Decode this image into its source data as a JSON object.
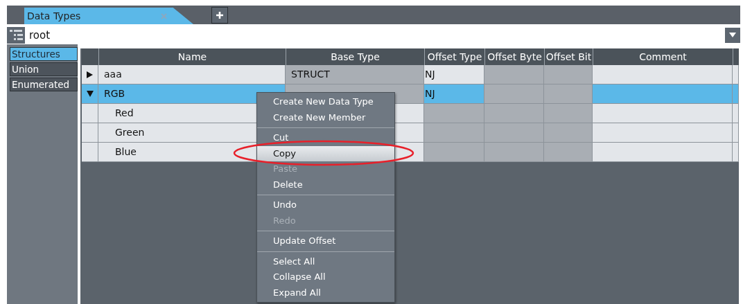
{
  "tabs": [
    {
      "label": "Data Types",
      "selected": true,
      "closable": true
    }
  ],
  "path_bar": {
    "value": "root"
  },
  "categories": [
    {
      "label": "Structures",
      "selected": true
    },
    {
      "label": "Union",
      "selected": false
    },
    {
      "label": "Enumerated",
      "selected": false
    }
  ],
  "table": {
    "columns": [
      "Name",
      "Base Type",
      "Offset Type",
      "Offset Byte",
      "Offset Bit",
      "Comment"
    ],
    "rows": [
      {
        "kind": "struct",
        "expanded": false,
        "selected": false,
        "cells": [
          {
            "text": "aaa",
            "editable": true
          },
          {
            "text": "STRUCT",
            "editable": false
          },
          {
            "text": "NJ",
            "editable": true
          },
          {
            "editable": false
          },
          {
            "editable": false
          },
          {
            "editable": true
          }
        ]
      },
      {
        "kind": "struct",
        "expanded": true,
        "selected": true,
        "cells": [
          {
            "text": "RGB",
            "editable": true
          },
          {
            "editable": false
          },
          {
            "text": "NJ",
            "editable": true
          },
          {
            "editable": false
          },
          {
            "editable": false
          },
          {
            "editable": true
          }
        ]
      },
      {
        "kind": "member",
        "selected": false,
        "cells": [
          {
            "text": "Red",
            "editable": true
          },
          {
            "editable": true
          },
          {
            "editable": false
          },
          {
            "editable": false
          },
          {
            "editable": false
          },
          {
            "editable": true
          }
        ]
      },
      {
        "kind": "member",
        "selected": false,
        "cells": [
          {
            "text": "Green",
            "editable": true
          },
          {
            "editable": true
          },
          {
            "editable": false
          },
          {
            "editable": false
          },
          {
            "editable": false
          },
          {
            "editable": true
          }
        ]
      },
      {
        "kind": "member",
        "selected": false,
        "cells": [
          {
            "text": "Blue",
            "editable": true
          },
          {
            "editable": true
          },
          {
            "editable": false
          },
          {
            "editable": false
          },
          {
            "editable": false
          },
          {
            "editable": true
          }
        ]
      }
    ]
  },
  "context_menu": {
    "groups": [
      [
        {
          "label": "Create New Data Type",
          "disabled": false,
          "selected": false
        },
        {
          "label": "Create New Member",
          "disabled": false,
          "selected": false
        }
      ],
      [
        {
          "label": "Cut",
          "disabled": false,
          "selected": false
        },
        {
          "label": "Copy",
          "disabled": false,
          "selected": true
        },
        {
          "label": "Paste",
          "disabled": true,
          "selected": false
        },
        {
          "label": "Delete",
          "disabled": false,
          "selected": false
        }
      ],
      [
        {
          "label": "Undo",
          "disabled": false,
          "selected": false
        },
        {
          "label": "Redo",
          "disabled": true,
          "selected": false
        }
      ],
      [
        {
          "label": "Update Offset",
          "disabled": false,
          "selected": false
        }
      ],
      [
        {
          "label": "Select All",
          "disabled": false,
          "selected": false
        },
        {
          "label": "Collapse All",
          "disabled": false,
          "selected": false
        },
        {
          "label": "Expand All",
          "disabled": false,
          "selected": false
        }
      ]
    ]
  }
}
